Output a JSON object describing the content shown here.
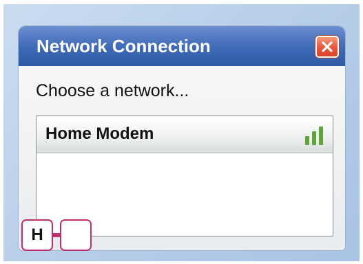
{
  "window": {
    "title": "Network Connection",
    "close_icon": "close-icon"
  },
  "dialog": {
    "prompt": "Choose a network..."
  },
  "networks": [
    {
      "name": "Home Modem",
      "signal_icon": "signal-strength-icon",
      "signal_bars_lit": 3,
      "signal_bars_total": 3
    }
  ],
  "tray": {
    "keys": [
      {
        "label": "H"
      },
      {
        "label": ""
      }
    ]
  },
  "colors": {
    "titlebar": "#3d69b6",
    "close_button": "#e7553a",
    "signal": "#5fa33a",
    "tray_outline": "#c0306a",
    "backdrop": "#b9cfea"
  }
}
